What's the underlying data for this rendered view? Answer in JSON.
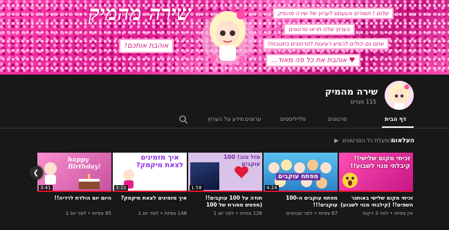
{
  "banner": {
    "title": "שירה מהמיק",
    "love_button": "אוהבת אותכם!",
    "cards": [
      "שלום ! חמודים והגעתם לערוץ של שירה מהמיק",
      "בערוץ שלנו תראו סרטונים",
      "אתם גם יכולים להציע רעיונות לסרטונים בתגובות!",
      "אוהבת את כל פה מאוד..."
    ],
    "heart": "♥"
  },
  "channel": {
    "name": "שירה מהמיק",
    "subscribers": "115 מנויים"
  },
  "tabs": [
    {
      "label": "דף הבית",
      "active": true
    },
    {
      "label": "סרטונים",
      "active": false
    },
    {
      "label": "פלייליסטים",
      "active": false
    },
    {
      "label": "ערוצים",
      "active": false
    },
    {
      "label": "מידע על הערוץ",
      "active": false
    }
  ],
  "uploads": {
    "title": "העלאות",
    "play_all": "להפעלת כל הסרטונים",
    "play_icon": "play-icon"
  },
  "videos": [
    {
      "title": "זכיתי מקום שלישי באותגר השפים!! (קילבתי מנוי לשבוע)",
      "meta": "אין צפיות • לפני 3 דקות",
      "duration": "",
      "thumb_text": "זכיתי מקום שלישי!! קיבלתי מנוי לשבוע!!",
      "color": "#e91e8c"
    },
    {
      "title": "מפתח עוקבים ה-100 עוקבים!!!",
      "meta": "67 צפיות • לפני שבועיים",
      "duration": "4:24",
      "thumb_text": "מפתח עוקבים",
      "color": "#2a9bd6"
    },
    {
      "title": "תודה על 100 עוקבים!! (מפסש מסורת של 100 עוקבים)",
      "meta": "126 צפיות • לפני יום 1",
      "duration": "1:58",
      "thumb_text": "מזל טוב! 100 עוקבים",
      "color": "#d9c3e8"
    },
    {
      "title": "איך מזמינים לצאת מיקמק?",
      "meta": "148 צפיות • לפני יום 1",
      "duration": "3:10",
      "thumb_text": "איך מזמינים לצאת מיקמק?",
      "color": "#ffffff"
    },
    {
      "title": "היום יום הולדת לרדיה!!",
      "meta": "85 צפיות • לפני יום 1",
      "duration": "3:41",
      "thumb_text": "happy Birthday!",
      "color": "#f06fc0"
    }
  ],
  "durations": {
    "v1": "4:24",
    "v2": "1:58",
    "v3": "3:10",
    "v4": "3:41"
  }
}
